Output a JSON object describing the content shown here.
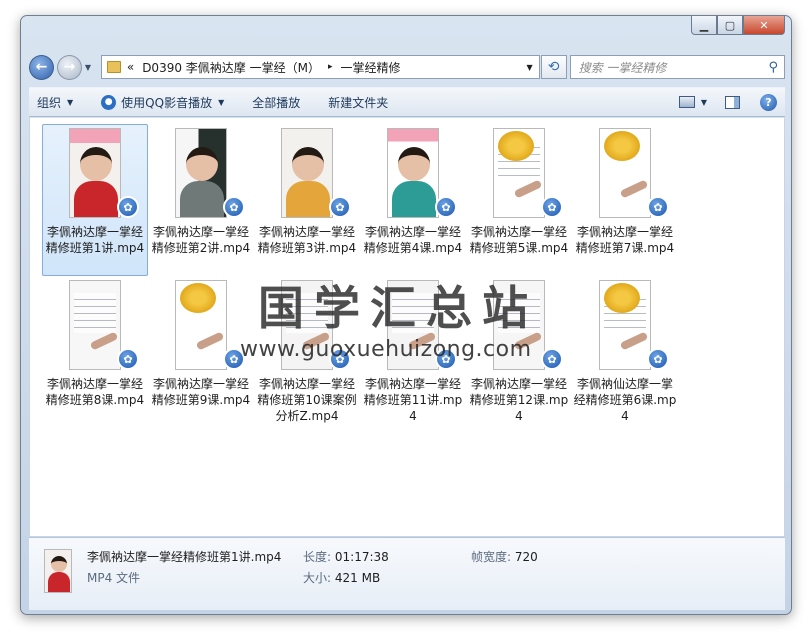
{
  "window": {
    "buttons": {
      "minimize": "▁",
      "maximize": "▢",
      "close": "✕"
    }
  },
  "nav": {
    "back_icon": "back-arrow-icon",
    "forward_icon": "forward-arrow-icon",
    "address": {
      "overflow": "«",
      "segments": [
        "D0390 李佩衲达摩 一掌经（M）",
        "一掌经精修"
      ],
      "separator": "▸"
    },
    "search_placeholder": "搜索 一掌经精修"
  },
  "toolbar": {
    "organize": "组织",
    "play_qq": "使用QQ影音播放",
    "play_all": "全部播放",
    "new_folder": "新建文件夹"
  },
  "files": [
    {
      "name": "李佩衲达摩一掌经精修班第1讲.mp4",
      "thumb": "pink-red",
      "selected": true
    },
    {
      "name": "李佩衲达摩一掌经精修班第2讲.mp4",
      "thumb": "board-grey"
    },
    {
      "name": "李佩衲达摩一掌经精修班第3讲.mp4",
      "thumb": "board-yellow"
    },
    {
      "name": "李佩衲达摩一掌经精修班第4课.mp4",
      "thumb": "pink-teal"
    },
    {
      "name": "李佩衲达摩一掌经精修班第5课.mp4",
      "thumb": "paper-yellow"
    },
    {
      "name": "李佩衲达摩一掌经精修班第7课.mp4",
      "thumb": "paper-yellow2"
    },
    {
      "name": "李佩衲达摩一掌经精修班第8课.mp4",
      "thumb": "paper-white"
    },
    {
      "name": "李佩衲达摩一掌经精修班第9课.mp4",
      "thumb": "paper-yellow3"
    },
    {
      "name": "李佩衲达摩一掌经精修班第10课案例分析Z.mp4",
      "thumb": "paper-white2"
    },
    {
      "name": "李佩衲达摩一掌经精修班第11讲.mp4",
      "thumb": "paper-white3"
    },
    {
      "name": "李佩衲达摩一掌经精修班第12课.mp4",
      "thumb": "paper-white4"
    },
    {
      "name": "李佩衲仙达摩一掌经精修班第6课.mp4",
      "thumb": "paper-yellow4"
    }
  ],
  "watermark": {
    "title": "国学汇总站",
    "url": "www.guoxuehuizong.com"
  },
  "details": {
    "name": "李佩衲达摩一掌经精修班第1讲.mp4",
    "type": "MP4 文件",
    "length_label": "长度:",
    "length_value": "01:17:38",
    "size_label": "大小:",
    "size_value": "421 MB",
    "width_label": "帧宽度:",
    "width_value": "720"
  },
  "colors": {
    "accent": "#2a6fc4",
    "selection": "#d0e5fa",
    "pink_banner": "#f2a3b8"
  }
}
